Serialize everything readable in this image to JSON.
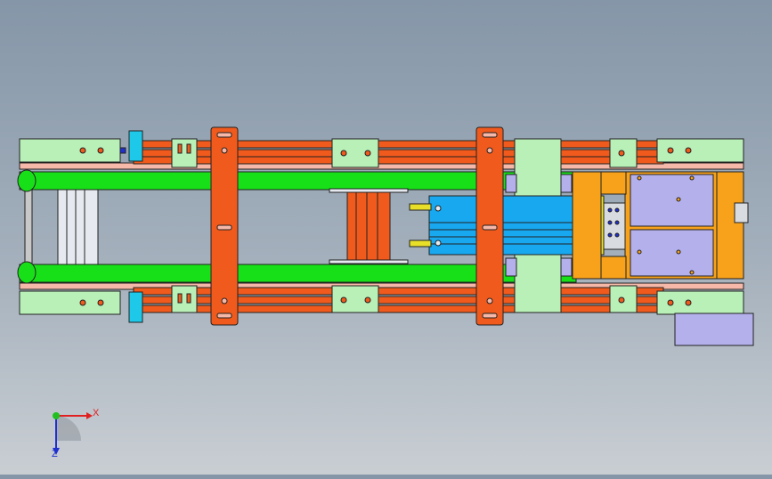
{
  "view": {
    "type": "cad-3d-viewport",
    "projection": "top",
    "background_top": "#8596a8",
    "background_bottom": "#c9ced3"
  },
  "triad": {
    "x_label": "X",
    "z_label": "Z",
    "x_color": "#e02020",
    "y_color": "#20c020",
    "z_color": "#2030d0"
  },
  "colors": {
    "light_green": "#b8f0b8",
    "bright_green": "#18e018",
    "orange_red": "#f05a1c",
    "orange": "#f7a21a",
    "lavender": "#b4b0ec",
    "cyan_block": "#1ec8e8",
    "blue_cylinder": "#18a8f0",
    "yellow_pin": "#e8e028",
    "white_silver": "#e6eaf0",
    "pink_rod": "#f6b8a8"
  }
}
